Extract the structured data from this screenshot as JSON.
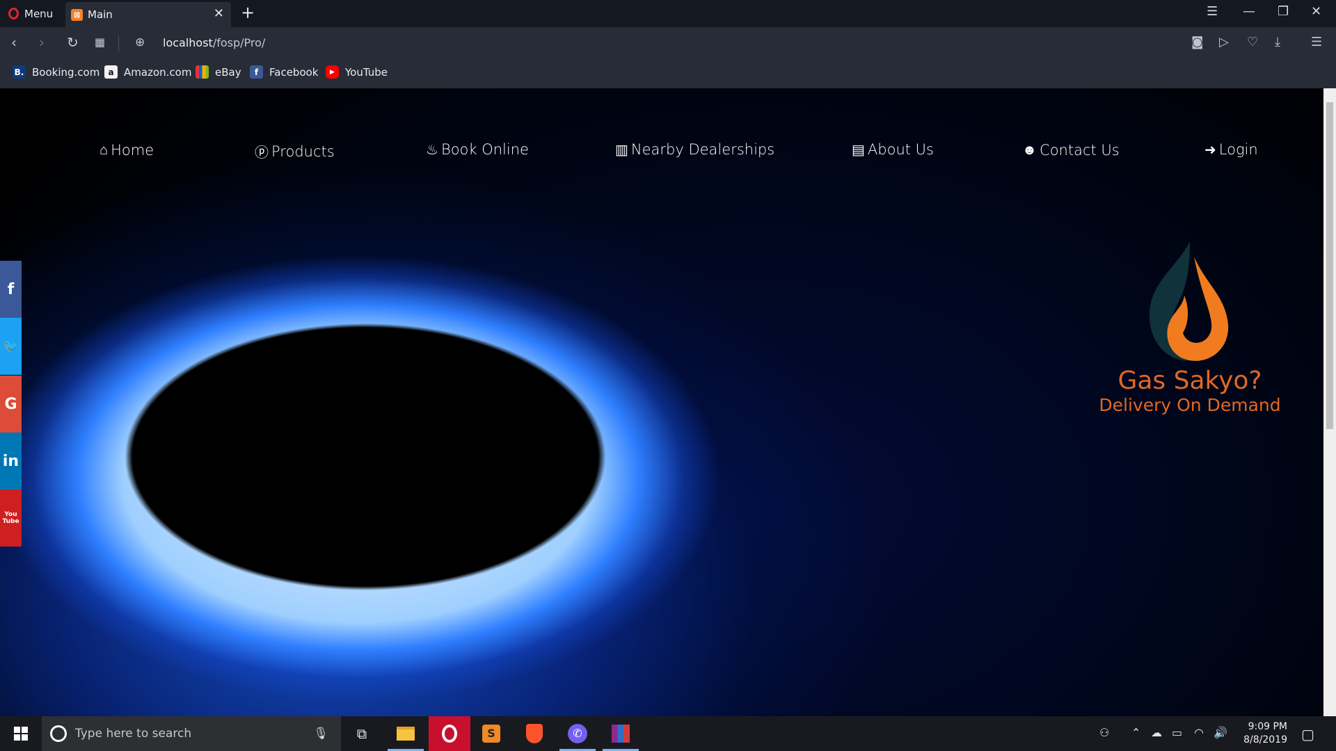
{
  "browser": {
    "menu_label": "Menu",
    "tab_title": "Main",
    "url_host": "localhost",
    "url_path": "/fosp/Pro/",
    "bookmarks": [
      {
        "label": "Booking.com",
        "icon": "B.",
        "color": "#0c3b7c"
      },
      {
        "label": "Amazon.com",
        "icon": "a",
        "color": "#f2f2f2"
      },
      {
        "label": "eBay",
        "icon": "bag-icon",
        "color": "#e53238"
      },
      {
        "label": "Facebook",
        "icon": "f",
        "color": "#3b5998"
      },
      {
        "label": "YouTube",
        "icon": "play-icon",
        "color": "#ff0000"
      }
    ]
  },
  "site": {
    "nav": [
      {
        "icon": "home-icon",
        "label": "Home"
      },
      {
        "icon": "product-icon",
        "label": "Products"
      },
      {
        "icon": "flame-icon",
        "label": "Book Online"
      },
      {
        "icon": "building-icon",
        "label": "Nearby Dealerships"
      },
      {
        "icon": "id-card-icon",
        "label": "About Us"
      },
      {
        "icon": "user-icon",
        "label": "Contact Us"
      },
      {
        "icon": "sign-in-icon",
        "label": "Login"
      }
    ],
    "logo": {
      "title": "Gas Sakyo?",
      "subtitle": "Delivery On Demand",
      "color": "#e06823"
    },
    "social": [
      {
        "name": "facebook",
        "glyph": "f",
        "color": "#3b5998"
      },
      {
        "name": "twitter",
        "glyph": "t",
        "color": "#1da1f2"
      },
      {
        "name": "google",
        "glyph": "G",
        "color": "#dd4b39"
      },
      {
        "name": "linkedin",
        "glyph": "in",
        "color": "#0077b5"
      },
      {
        "name": "youtube",
        "glyph": "You Tube",
        "color": "#cd201f"
      }
    ]
  },
  "taskbar": {
    "search_placeholder": "Type here to search",
    "time": "9:09 PM",
    "date": "8/8/2019"
  }
}
